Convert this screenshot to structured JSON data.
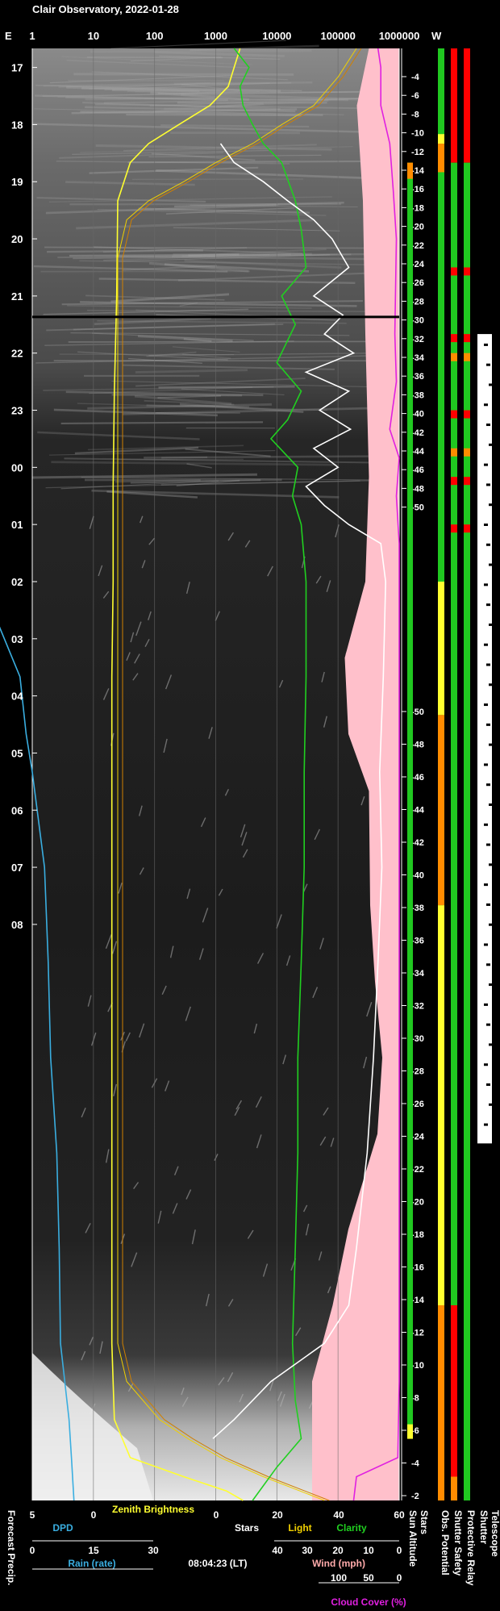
{
  "title": "Clair Observatory, 2022-01-28",
  "timestamp": "08:04:23 (LT)",
  "colors": {
    "dpd": "#3aaee0",
    "rain": "#3aaee0",
    "zenith": "#ffff30",
    "stars": "#ffffff",
    "light": "#f0d000",
    "clarity": "#20d020",
    "wind": "#ffaaaa",
    "cloud": "#e020e0",
    "cloud_fill": "#ffc0cb",
    "sun": "#ff9a00",
    "ok": "#20c820",
    "bad": "#ff0000",
    "warn": "#ff8c00",
    "caution": "#ffff30"
  },
  "chart_data": {
    "type": "line",
    "title": "Clair Observatory, 2022-01-28",
    "top_axis": {
      "left_label": "E",
      "right_label": "W",
      "scale": "log",
      "ticks": [
        "1",
        "10",
        "100",
        "1000",
        "10000",
        "100000",
        "1000000"
      ]
    },
    "hour_ticks": [
      "17",
      "18",
      "19",
      "20",
      "21",
      "22",
      "23",
      "00",
      "01",
      "02",
      "03",
      "04",
      "05",
      "06",
      "07",
      "08"
    ],
    "time_range": [
      "16:40",
      "08:05"
    ],
    "sun_altitude_ticks_evening": [
      "-4",
      "-6",
      "-8",
      "-10",
      "-12",
      "-14",
      "-16",
      "-18",
      "-20",
      "-22",
      "-24",
      "-26",
      "-28",
      "-30",
      "-32",
      "-34",
      "-36",
      "-38",
      "-40",
      "-42",
      "-44",
      "-46",
      "-48",
      "-50"
    ],
    "sun_altitude_ticks_morning": [
      "-50",
      "-48",
      "-46",
      "-44",
      "-42",
      "-40",
      "-38",
      "-36",
      "-34",
      "-32",
      "-30",
      "-28",
      "-26",
      "-24",
      "-22",
      "-20",
      "-18",
      "-16",
      "-14",
      "-12",
      "-10",
      "-8",
      "-6",
      "-4",
      "-2"
    ],
    "bottom_axes": {
      "row1": {
        "dpd": {
          "label": "DPD",
          "ticks": [
            "5",
            "0"
          ]
        },
        "zenith": {
          "label": "Zenith Brightness",
          "ticks": [
            "20"
          ]
        },
        "stars": {
          "label": "Stars",
          "ticks": [
            "0",
            "20",
            "40",
            "60"
          ]
        },
        "light": {
          "label": "Light"
        },
        "clarity": {
          "label": "Clarity"
        }
      },
      "row2": {
        "rain": {
          "label": "Rain (rate)",
          "ticks": [
            "0",
            "15",
            "30"
          ]
        },
        "wind": {
          "label": "Wind (mph)",
          "ticks": [
            "40",
            "30",
            "20",
            "10",
            "0"
          ]
        }
      },
      "row3": {
        "cloud": {
          "label": "Cloud Cover (%)",
          "ticks": [
            "100",
            "50",
            "0"
          ]
        }
      }
    },
    "side_labels": [
      "Forecast Precip.",
      "Sun Altitude",
      "Stars",
      "Obs. Potential",
      "Shutter Safety",
      "Protective Relay",
      "Shutter",
      "Telescope"
    ],
    "series": [
      {
        "name": "Zenith Brightness",
        "key": "zenith",
        "points": [
          [
            0,
            2500
          ],
          [
            20,
            2000
          ],
          [
            40,
            1600
          ],
          [
            60,
            800
          ],
          [
            80,
            250
          ],
          [
            100,
            80
          ],
          [
            120,
            40
          ],
          [
            160,
            25
          ],
          [
            260,
            24
          ],
          [
            360,
            22
          ],
          [
            460,
            21
          ],
          [
            560,
            21
          ],
          [
            660,
            20
          ],
          [
            760,
            20
          ],
          [
            860,
            20
          ],
          [
            960,
            20
          ],
          [
            1060,
            20
          ],
          [
            1160,
            20
          ],
          [
            1260,
            20
          ],
          [
            1360,
            20
          ],
          [
            1440,
            22
          ],
          [
            1480,
            40
          ],
          [
            1500,
            300
          ],
          [
            1515,
            1500
          ],
          [
            1525,
            2800
          ]
        ]
      },
      {
        "name": "Light",
        "key": "light",
        "points": [
          [
            0,
            200000
          ],
          [
            30,
            100000
          ],
          [
            60,
            40000
          ],
          [
            80,
            12000
          ],
          [
            100,
            4000
          ],
          [
            120,
            1000
          ],
          [
            140,
            300
          ],
          [
            160,
            80
          ],
          [
            180,
            35
          ],
          [
            220,
            25
          ],
          [
            1360,
            25
          ],
          [
            1400,
            35
          ],
          [
            1440,
            120
          ],
          [
            1460,
            350
          ],
          [
            1480,
            1200
          ],
          [
            1500,
            6000
          ],
          [
            1525,
            60000
          ]
        ]
      },
      {
        "name": "Clarity",
        "key": "clarity",
        "points": [
          [
            0,
            2000
          ],
          [
            20,
            3500
          ],
          [
            40,
            2500
          ],
          [
            60,
            2800
          ],
          [
            80,
            4000
          ],
          [
            100,
            6000
          ],
          [
            120,
            12000
          ],
          [
            160,
            20000
          ],
          [
            190,
            25000
          ],
          [
            230,
            30000
          ],
          [
            260,
            12000
          ],
          [
            290,
            20000
          ],
          [
            330,
            10000
          ],
          [
            360,
            25000
          ],
          [
            390,
            15000
          ],
          [
            410,
            8000
          ],
          [
            440,
            22000
          ],
          [
            470,
            18000
          ],
          [
            500,
            25000
          ],
          [
            560,
            30000
          ],
          [
            660,
            30000
          ],
          [
            760,
            28000
          ],
          [
            860,
            28000
          ],
          [
            960,
            25000
          ],
          [
            1060,
            22000
          ],
          [
            1160,
            22000
          ],
          [
            1260,
            20000
          ],
          [
            1360,
            18000
          ],
          [
            1420,
            20000
          ],
          [
            1460,
            25000
          ],
          [
            1490,
            10000
          ],
          [
            1525,
            4000
          ]
        ]
      },
      {
        "name": "Stars",
        "key": "stars",
        "points": [
          [
            100,
            1200
          ],
          [
            120,
            2000
          ],
          [
            140,
            6000
          ],
          [
            160,
            15000
          ],
          [
            180,
            40000
          ],
          [
            200,
            80000
          ],
          [
            230,
            150000
          ],
          [
            260,
            40000
          ],
          [
            280,
            120000
          ],
          [
            300,
            60000
          ],
          [
            320,
            180000
          ],
          [
            340,
            30000
          ],
          [
            360,
            150000
          ],
          [
            380,
            50000
          ],
          [
            400,
            160000
          ],
          [
            420,
            40000
          ],
          [
            440,
            100000
          ],
          [
            460,
            30000
          ],
          [
            480,
            60000
          ],
          [
            500,
            150000
          ],
          [
            520,
            500000
          ],
          [
            560,
            600000
          ],
          [
            660,
            550000
          ],
          [
            760,
            480000
          ],
          [
            860,
            520000
          ],
          [
            960,
            450000
          ],
          [
            1060,
            380000
          ],
          [
            1160,
            300000
          ],
          [
            1260,
            200000
          ],
          [
            1320,
            150000
          ],
          [
            1360,
            60000
          ],
          [
            1400,
            8000
          ],
          [
            1440,
            2000
          ],
          [
            1460,
            900
          ]
        ]
      },
      {
        "name": "DPD",
        "key": "dpd",
        "points": [
          [
            0,
            9.2
          ],
          [
            200,
            9.3
          ],
          [
            400,
            9.4
          ],
          [
            560,
            9.2
          ],
          [
            660,
            6.0
          ],
          [
            720,
            5.5
          ],
          [
            760,
            5.0
          ],
          [
            860,
            4.0
          ],
          [
            960,
            3.7
          ],
          [
            1060,
            3.5
          ],
          [
            1160,
            3.0
          ],
          [
            1260,
            2.8
          ],
          [
            1360,
            2.7
          ],
          [
            1440,
            2.0
          ],
          [
            1480,
            1.8
          ],
          [
            1525,
            1.6
          ]
        ]
      },
      {
        "name": "Cloud Cover",
        "key": "cloud",
        "points": [
          [
            0,
            450000
          ],
          [
            20,
            500000
          ],
          [
            60,
            500000
          ],
          [
            100,
            700000
          ],
          [
            150,
            800000
          ],
          [
            200,
            900000
          ],
          [
            300,
            850000
          ],
          [
            350,
            900000
          ],
          [
            400,
            700000
          ],
          [
            430,
            1000000
          ],
          [
            470,
            900000
          ],
          [
            520,
            1000000
          ],
          [
            600,
            1000000
          ],
          [
            800,
            1000000
          ],
          [
            1000,
            1000000
          ],
          [
            1200,
            1000000
          ],
          [
            1400,
            1000000
          ],
          [
            1480,
            950000
          ],
          [
            1500,
            200000
          ],
          [
            1525,
            180000
          ]
        ]
      }
    ],
    "status_bars": {
      "sun_altitude": [
        [
          "0",
          "1520",
          "ok"
        ],
        [
          "1445",
          "1460",
          "caution"
        ]
      ],
      "obs_potential": [
        [
          "0",
          "1360",
          "ok"
        ],
        [
          "90",
          "100",
          "caution"
        ],
        [
          "100",
          "130",
          "warn"
        ],
        [
          "140",
          "560",
          "ok"
        ],
        [
          "560",
          "700",
          "caution"
        ],
        [
          "700",
          "900",
          "warn"
        ],
        [
          "900",
          "1320",
          "caution"
        ],
        [
          "1320",
          "1525",
          "warn"
        ]
      ],
      "shutter_safety": [
        [
          "0",
          "120",
          "bad"
        ],
        [
          "120",
          "1320",
          "ok"
        ],
        [
          "1320",
          "1500",
          "bad"
        ],
        [
          "1500",
          "1525",
          "warn"
        ]
      ],
      "protective_relay": [
        [
          "0",
          "120",
          "bad"
        ],
        [
          "120",
          "1525",
          "ok"
        ]
      ]
    },
    "telescope_segments": [
      [
        520,
        1150
      ],
      [
        560,
        1040
      ],
      [
        600,
        780
      ]
    ]
  }
}
